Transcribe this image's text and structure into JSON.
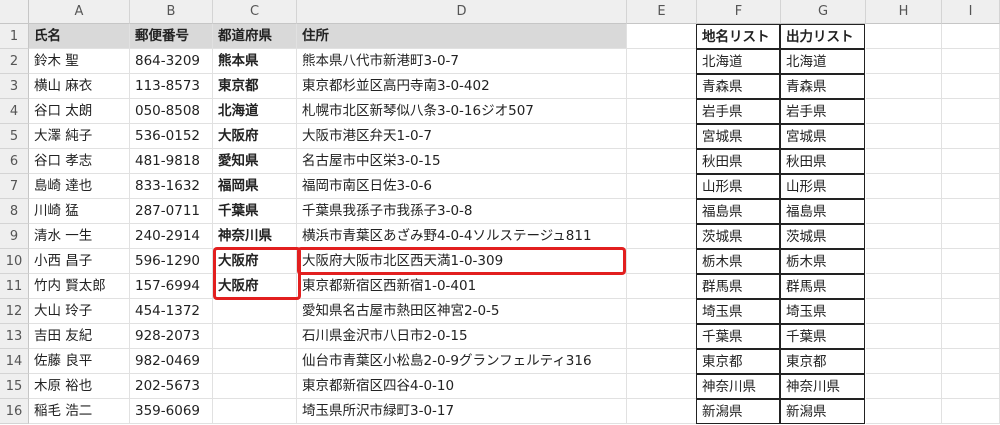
{
  "columns": [
    "A",
    "B",
    "C",
    "D",
    "E",
    "F",
    "G",
    "H",
    "I"
  ],
  "rows": [
    "1",
    "2",
    "3",
    "4",
    "5",
    "6",
    "7",
    "8",
    "9",
    "10",
    "11",
    "12",
    "13",
    "14",
    "15",
    "16"
  ],
  "header": {
    "name": "氏名",
    "zip": "郵便番号",
    "pref": "都道府県",
    "address": "住所",
    "place_list": "地名リスト",
    "output_list": "出力リスト"
  },
  "records": [
    {
      "name": "鈴木 聖",
      "zip": "864-3209",
      "pref": "熊本県",
      "address": "熊本県八代市新港町3-0-7",
      "place": "北海道",
      "output": "北海道"
    },
    {
      "name": "横山 麻衣",
      "zip": "113-8573",
      "pref": "東京都",
      "address": "東京都杉並区高円寺南3-0-402",
      "place": "青森県",
      "output": "青森県"
    },
    {
      "name": "谷口 太朗",
      "zip": "050-8508",
      "pref": "北海道",
      "address": "札幌市北区新琴似八条3-0-16ジオ507",
      "place": "岩手県",
      "output": "岩手県"
    },
    {
      "name": "大澤 純子",
      "zip": "536-0152",
      "pref": "大阪府",
      "address": "大阪市港区弁天1-0-7",
      "place": "宮城県",
      "output": "宮城県"
    },
    {
      "name": "谷口 孝志",
      "zip": "481-9818",
      "pref": "愛知県",
      "address": "名古屋市中区栄3-0-15",
      "place": "秋田県",
      "output": "秋田県"
    },
    {
      "name": "島崎 達也",
      "zip": "833-1632",
      "pref": "福岡県",
      "address": "福岡市南区日佐3-0-6",
      "place": "山形県",
      "output": "山形県"
    },
    {
      "name": "川崎 猛",
      "zip": "287-0711",
      "pref": "千葉県",
      "address": "千葉県我孫子市我孫子3-0-8",
      "place": "福島県",
      "output": "福島県"
    },
    {
      "name": "清水 一生",
      "zip": "240-2914",
      "pref": "神奈川県",
      "address": "横浜市青葉区あざみ野4-0-4ソルステージュ811",
      "place": "茨城県",
      "output": "茨城県"
    },
    {
      "name": "小西 昌子",
      "zip": "596-1290",
      "pref": "大阪府",
      "address": "大阪府大阪市北区西天満1-0-309",
      "place": "栃木県",
      "output": "栃木県"
    },
    {
      "name": "竹内 賢太郎",
      "zip": "157-6994",
      "pref": "大阪府",
      "address": "東京都新宿区西新宿1-0-401",
      "place": "群馬県",
      "output": "群馬県"
    },
    {
      "name": "大山 玲子",
      "zip": "454-1372",
      "pref": "",
      "address": "愛知県名古屋市熱田区神宮2-0-5",
      "place": "埼玉県",
      "output": "埼玉県"
    },
    {
      "name": "吉田 友紀",
      "zip": "928-2073",
      "pref": "",
      "address": "石川県金沢市八日市2-0-15",
      "place": "千葉県",
      "output": "千葉県"
    },
    {
      "name": "佐藤 良平",
      "zip": "982-0469",
      "pref": "",
      "address": "仙台市青葉区小松島2-0-9グランフェルティ316",
      "place": "東京都",
      "output": "東京都"
    },
    {
      "name": "木原 裕也",
      "zip": "202-5673",
      "pref": "",
      "address": "東京都新宿区四谷4-0-10",
      "place": "神奈川県",
      "output": "神奈川県"
    },
    {
      "name": "稲毛 浩二",
      "zip": "359-6069",
      "pref": "",
      "address": "埼玉県所沢市緑町3-0-17",
      "place": "新潟県",
      "output": "新潟県"
    }
  ],
  "highlight_color": "#e21f1f"
}
